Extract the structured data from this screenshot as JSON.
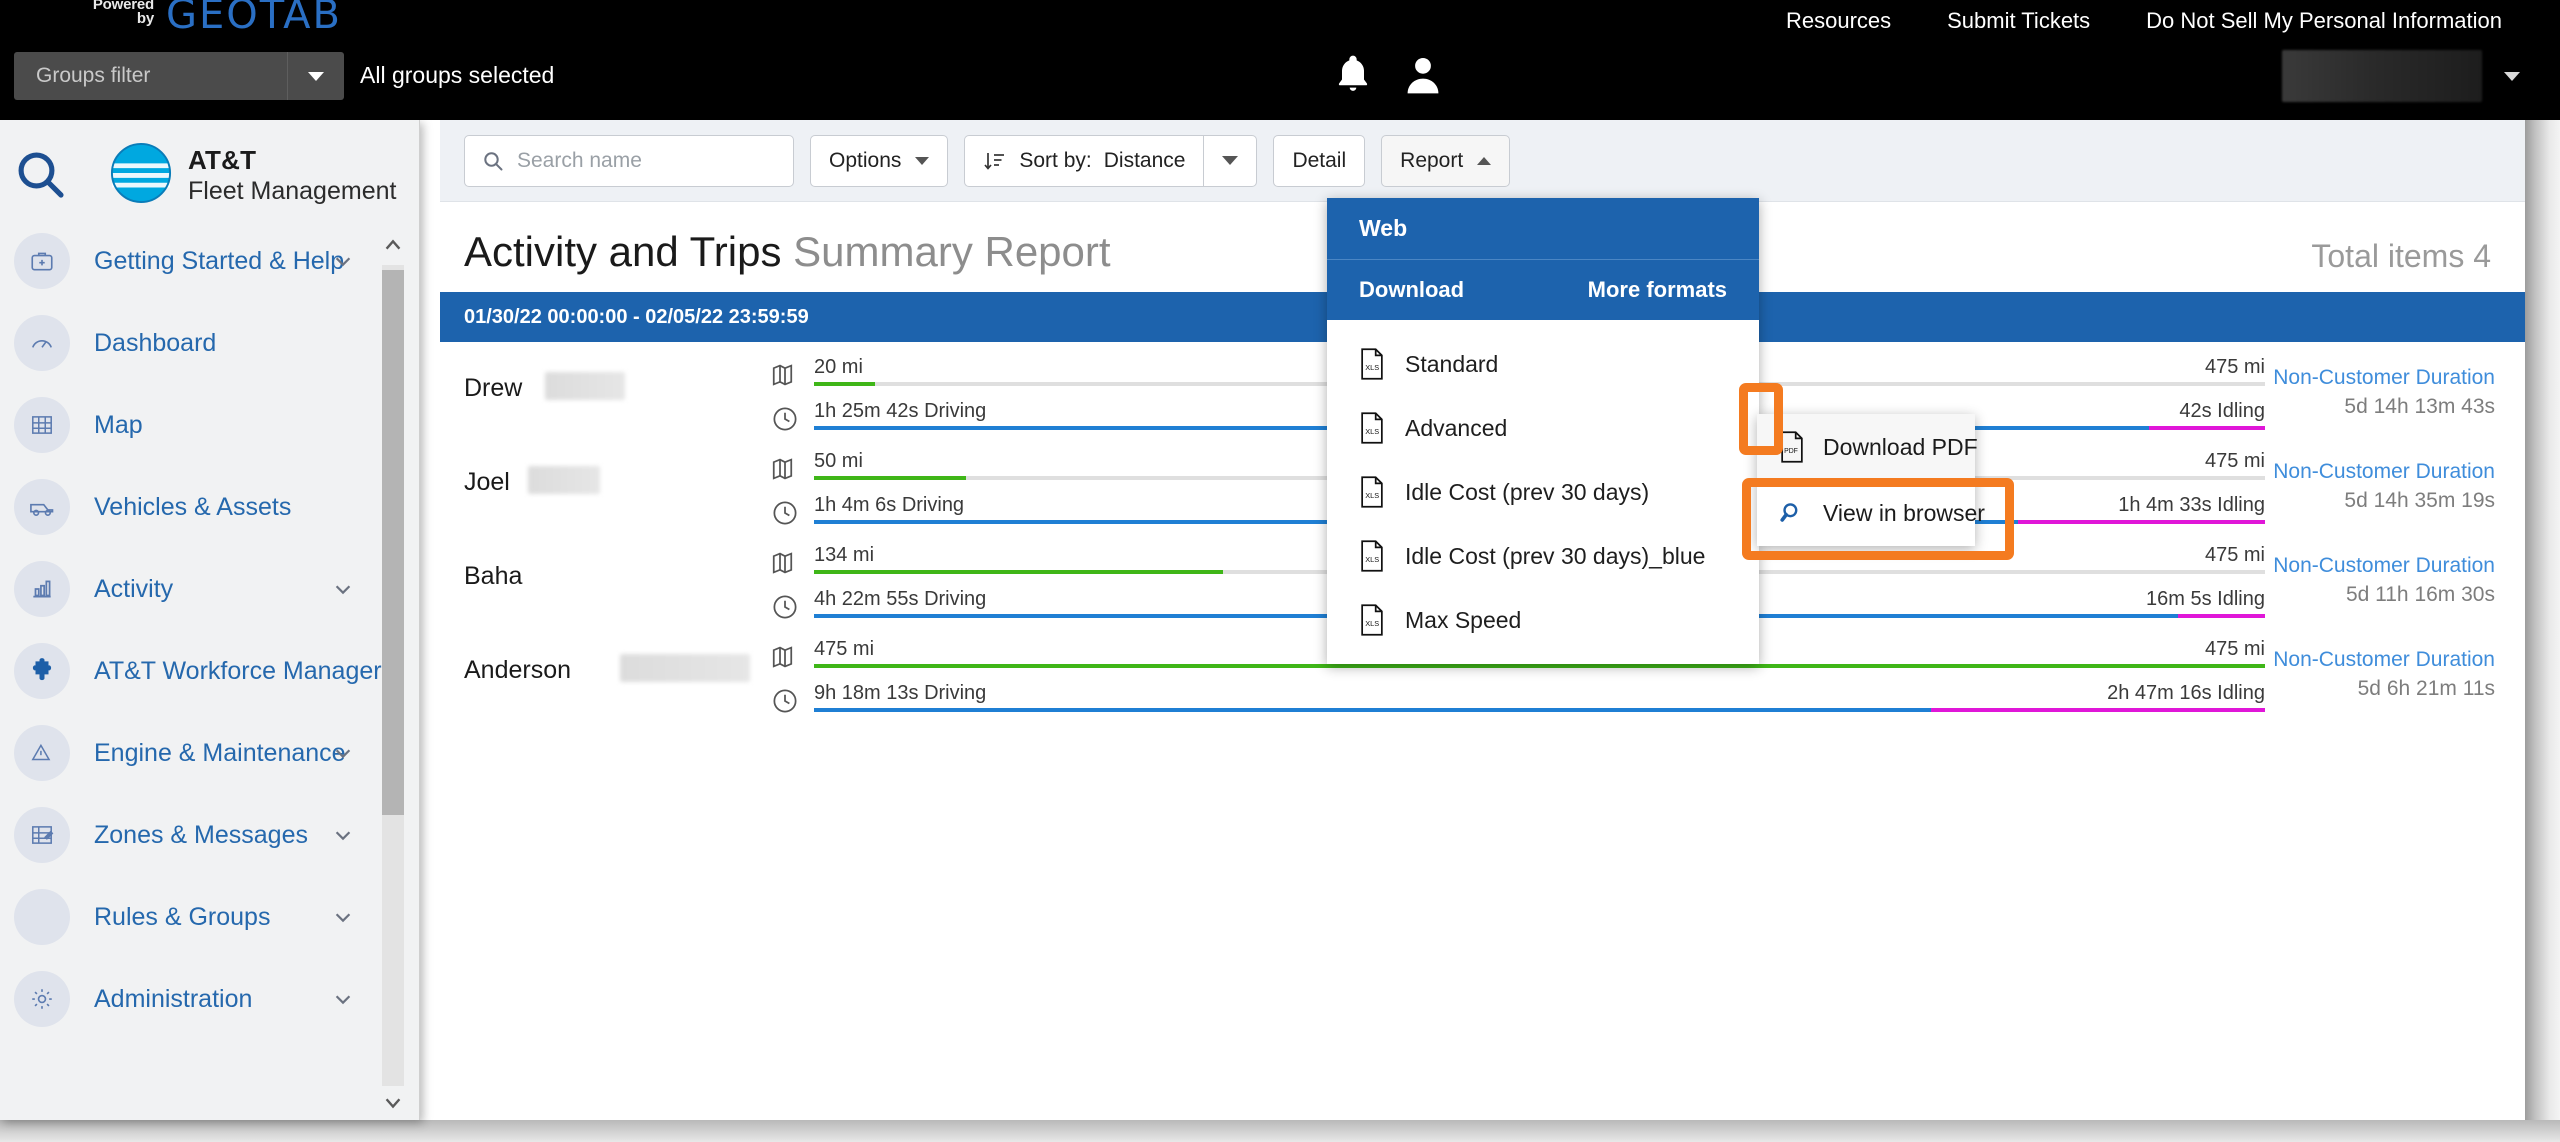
{
  "topbar": {
    "powered_line1": "Powered",
    "powered_line2": "by",
    "brand": "GEOTAB",
    "groups_filter_label": "Groups filter",
    "groups_selected": "All groups selected",
    "links": [
      "Resources",
      "Submit Tickets",
      "Do Not Sell My Personal Information"
    ],
    "bell_icon": "notification-bell-icon",
    "user_icon": "user-avatar-icon",
    "user_caret": "chevron-down-icon"
  },
  "sidebar": {
    "search_icon": "search-icon",
    "brand_line1": "AT&T",
    "brand_line2": "Fleet Management",
    "items": [
      {
        "label": "Getting Started & Help",
        "icon": "help-kit-icon",
        "expandable": true
      },
      {
        "label": "Dashboard",
        "icon": "gauge-icon",
        "expandable": false
      },
      {
        "label": "Map",
        "icon": "map-grid-icon",
        "expandable": false
      },
      {
        "label": "Vehicles & Assets",
        "icon": "vehicle-icon",
        "expandable": false
      },
      {
        "label": "Activity",
        "icon": "bar-chart-icon",
        "expandable": true
      },
      {
        "label": "AT&T Workforce Manager",
        "icon": "puzzle-piece-icon",
        "expandable": false
      },
      {
        "label": "Engine & Maintenance",
        "icon": "engine-warning-icon",
        "expandable": true
      },
      {
        "label": "Zones & Messages",
        "icon": "zone-pencil-icon",
        "expandable": true
      },
      {
        "label": "Rules & Groups",
        "icon": "rules-icon",
        "expandable": true
      },
      {
        "label": "Administration",
        "icon": "gear-icon",
        "expandable": true
      }
    ]
  },
  "toolbar": {
    "search_placeholder": "Search name",
    "search_value": "",
    "search_icon": "search-icon",
    "options_label": "Options",
    "sort_icon": "sort-descending-icon",
    "sort_prefix": "Sort by:",
    "sort_value": "Distance",
    "detail_label": "Detail",
    "report_label": "Report"
  },
  "report": {
    "title_bold": "Activity and Trips",
    "title_light": "Summary Report",
    "total_items": "Total items 4",
    "date_range": "01/30/22 00:00:00 - 02/05/22 23:59:59"
  },
  "report_menu": {
    "web_label": "Web",
    "download_label": "Download",
    "more_formats_label": "More formats",
    "items": [
      {
        "label": "Standard",
        "icon": "xls-file-icon",
        "kebab": "more-options-icon"
      },
      {
        "label": "Advanced",
        "icon": "xls-file-icon",
        "kebab": "more-options-icon"
      },
      {
        "label": "Idle Cost (prev 30 days)",
        "icon": "xls-file-icon",
        "kebab": "more-options-icon"
      },
      {
        "label": "Idle Cost (prev 30 days)_blue",
        "icon": "xls-file-icon",
        "kebab": "more-options-icon"
      },
      {
        "label": "Max Speed",
        "icon": "xls-file-icon",
        "kebab": "more-options-icon"
      }
    ]
  },
  "sub_menu": {
    "items": [
      {
        "label": "Download PDF",
        "icon": "pdf-file-icon"
      },
      {
        "label": "View in browser",
        "icon": "magnifier-icon"
      }
    ]
  },
  "colors": {
    "brand_blue": "#1d63ad",
    "distance_green": "#3fb618",
    "driving_blue": "#1f7fd4",
    "idling_magenta": "#e016d8",
    "highlight_orange": "#f47b20",
    "link_blue": "#3f8ddb"
  },
  "rows": [
    {
      "name": "Drew",
      "name_redacted": true,
      "distance_icon": "map-icon",
      "distance_label": "20 mi",
      "distance_max": "475 mi",
      "distance_pct": 4.2,
      "time_icon": "clock-icon",
      "driving_label": "1h 25m 42s Driving",
      "idling_label": "42s Idling",
      "driving_pct": 92,
      "idling_pct": 8,
      "nc_title": "Non-Customer Duration",
      "nc_value": "5d 14h 13m 43s"
    },
    {
      "name": "Joel",
      "name_redacted": true,
      "distance_icon": "map-icon",
      "distance_label": "50 mi",
      "distance_max": "475 mi",
      "distance_pct": 10.5,
      "time_icon": "clock-icon",
      "driving_label": "1h 4m 6s Driving",
      "idling_label": "1h 4m 33s Idling",
      "driving_pct": 83,
      "idling_pct": 17,
      "nc_title": "Non-Customer Duration",
      "nc_value": "5d 14h 35m 19s"
    },
    {
      "name": "Baha",
      "name_redacted": false,
      "distance_icon": "map-icon",
      "distance_label": "134 mi",
      "distance_max": "475 mi",
      "distance_pct": 28.2,
      "time_icon": "clock-icon",
      "driving_label": "4h 22m 55s Driving",
      "idling_label": "16m 5s Idling",
      "driving_pct": 94,
      "idling_pct": 6,
      "nc_title": "Non-Customer Duration",
      "nc_value": "5d 11h 16m 30s"
    },
    {
      "name": "Anderson",
      "name_redacted": true,
      "distance_icon": "map-icon",
      "distance_label": "475 mi",
      "distance_max": "475 mi",
      "distance_pct": 100,
      "time_icon": "clock-icon",
      "driving_label": "9h 18m 13s Driving",
      "idling_label": "2h 47m 16s Idling",
      "driving_pct": 77,
      "idling_pct": 23,
      "nc_title": "Non-Customer Duration",
      "nc_value": "5d 6h 21m 11s"
    }
  ]
}
